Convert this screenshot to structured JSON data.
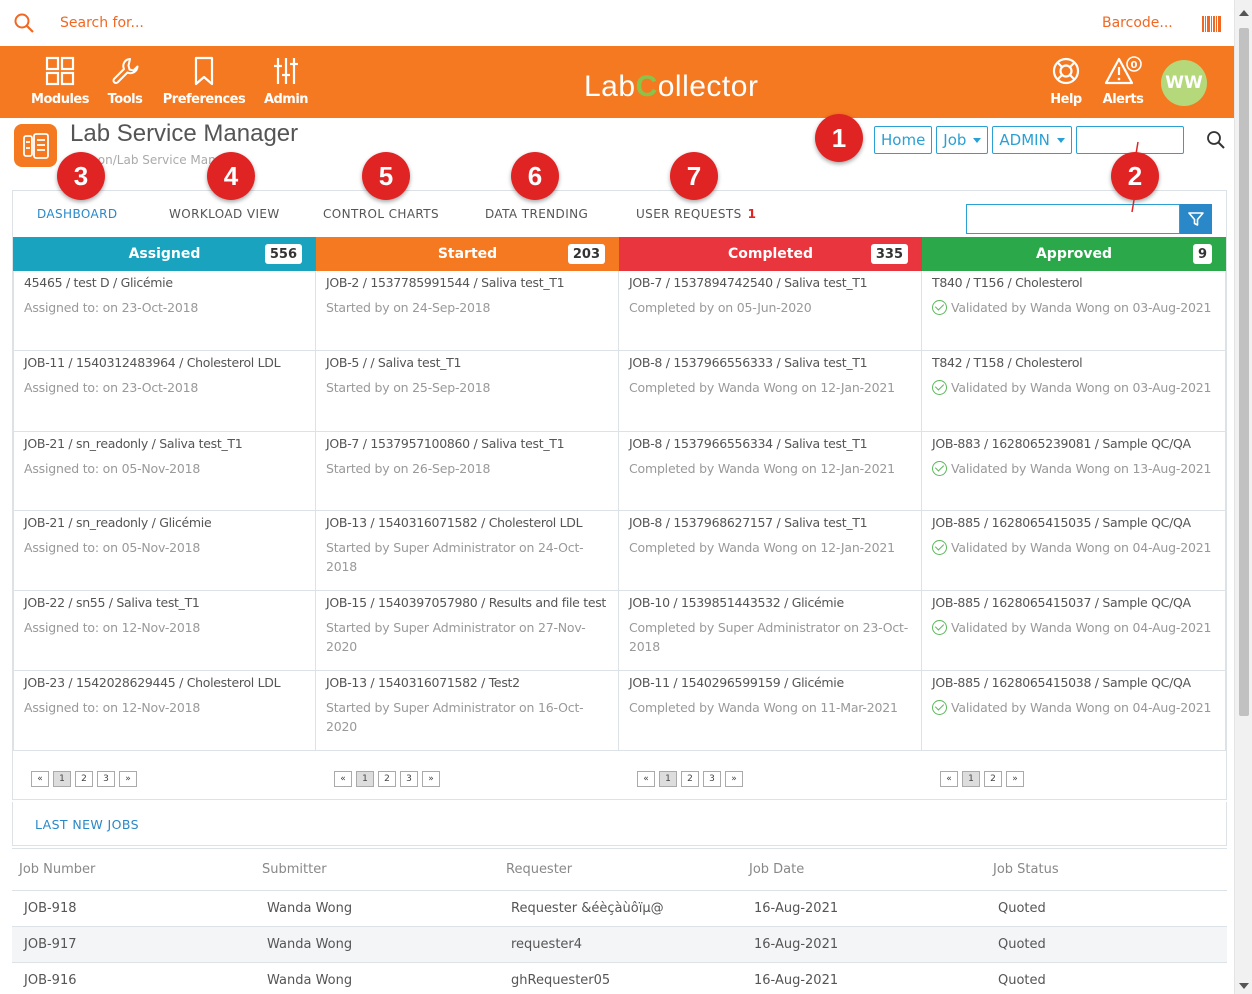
{
  "search": {
    "placeholder": "Search for...",
    "barcode_label": "Barcode..."
  },
  "nav": {
    "items": [
      {
        "label": "Modules",
        "icon": "grid-icon"
      },
      {
        "label": "Tools",
        "icon": "wrench-icon"
      },
      {
        "label": "Preferences",
        "icon": "bookmark-icon"
      },
      {
        "label": "Admin",
        "icon": "sliders-icon"
      }
    ],
    "logo_left": "Lab",
    "logo_c": "C",
    "logo_right": "ollector",
    "help_label": "Help",
    "alerts_label": "Alerts",
    "alerts_count": "0",
    "avatar_initials": "WW",
    "accent_color": "#f47920"
  },
  "header": {
    "title": "Lab Service Manager",
    "breadcrumb": "Add-on/Lab Service Manager",
    "home_btn": "Home",
    "job_btn": "Job",
    "admin_btn": "ADMIN"
  },
  "callouts": [
    "1",
    "2",
    "3",
    "4",
    "5",
    "6",
    "7"
  ],
  "tabs": [
    {
      "label": "DASHBOARD",
      "active": true
    },
    {
      "label": "WORKLOAD VIEW"
    },
    {
      "label": "CONTROL CHARTS"
    },
    {
      "label": "DATA TRENDING"
    },
    {
      "label": "USER REQUESTS",
      "count": "1"
    }
  ],
  "columns": [
    {
      "name": "Assigned",
      "count": "556",
      "color": "#1aa3bf",
      "cards": [
        {
          "title": "45465 / test D / Glicémie",
          "line": "Assigned to: on 23-Oct-2018"
        },
        {
          "title": "JOB-11 / 1540312483964 / Cholesterol LDL",
          "line": "Assigned to: on 23-Oct-2018"
        },
        {
          "title": "JOB-21 / sn_readonly / Saliva test_T1",
          "line": "Assigned to: on 05-Nov-2018"
        },
        {
          "title": "JOB-21 / sn_readonly / Glicémie",
          "line": "Assigned to: on 05-Nov-2018"
        },
        {
          "title": "JOB-22 / sn55 / Saliva test_T1",
          "line": "Assigned to: on 12-Nov-2018"
        },
        {
          "title": "JOB-23 / 1542028629445 / Cholesterol LDL",
          "line": "Assigned to: on 12-Nov-2018"
        }
      ],
      "pages": [
        "«",
        "1",
        "2",
        "3",
        "»"
      ]
    },
    {
      "name": "Started",
      "count": "203",
      "color": "#f47920",
      "cards": [
        {
          "title": "JOB-2 / 1537785991544 / Saliva test_T1",
          "line": "Started by on 24-Sep-2018"
        },
        {
          "title": "JOB-5 / / Saliva test_T1",
          "line": "Started by on 25-Sep-2018"
        },
        {
          "title": "JOB-7 / 1537957100860 / Saliva test_T1",
          "line": "Started by on 26-Sep-2018"
        },
        {
          "title": "JOB-13 / 1540316071582 / Cholesterol LDL",
          "line": "Started by Super Administrator on 24-Oct-2018"
        },
        {
          "title": "JOB-15 / 1540397057980 / Results and file test",
          "line": "Started by Super Administrator on 27-Nov-2020"
        },
        {
          "title": "JOB-13 / 1540316071582 / Test2",
          "line": "Started by Super Administrator on 16-Oct-2020"
        }
      ],
      "pages": [
        "«",
        "1",
        "2",
        "3",
        "»"
      ]
    },
    {
      "name": "Completed",
      "count": "335",
      "color": "#e8353e",
      "cards": [
        {
          "title": "JOB-7 / 1537894742540 / Saliva test_T1",
          "line": "Completed by on 05-Jun-2020"
        },
        {
          "title": "JOB-8 / 1537966556333 / Saliva test_T1",
          "line": "Completed by Wanda Wong on 12-Jan-2021"
        },
        {
          "title": "JOB-8 / 1537966556334 / Saliva test_T1",
          "line": "Completed by Wanda Wong on 12-Jan-2021"
        },
        {
          "title": "JOB-8 / 1537968627157 / Saliva test_T1",
          "line": "Completed by Wanda Wong on 12-Jan-2021"
        },
        {
          "title": "JOB-10 / 1539851443532 / Glicémie",
          "line": "Completed by Super Administrator on 23-Oct-2018"
        },
        {
          "title": "JOB-11 / 1540296599159 / Glicémie",
          "line": "Completed by Wanda Wong on 11-Mar-2021"
        }
      ],
      "pages": [
        "«",
        "1",
        "2",
        "3",
        "»"
      ]
    },
    {
      "name": "Approved",
      "count": "9",
      "color": "#2aa84a",
      "cards": [
        {
          "title": "T840 / T156 / Cholesterol",
          "line": "Validated by Wanda Wong on 03-Aug-2021"
        },
        {
          "title": "T842 / T158 / Cholesterol",
          "line": "Validated by Wanda Wong on 03-Aug-2021"
        },
        {
          "title": "JOB-883 / 1628065239081 / Sample QC/QA",
          "line": "Validated by Wanda Wong on 13-Aug-2021"
        },
        {
          "title": "JOB-885 / 1628065415035 / Sample QC/QA",
          "line": "Validated by Wanda Wong on 04-Aug-2021"
        },
        {
          "title": "JOB-885 / 1628065415037 / Sample QC/QA",
          "line": "Validated by Wanda Wong on 04-Aug-2021"
        },
        {
          "title": "JOB-885 / 1628065415038 / Sample QC/QA",
          "line": "Validated by Wanda Wong on 04-Aug-2021"
        }
      ],
      "pages": [
        "«",
        "1",
        "2",
        "»"
      ]
    }
  ],
  "last_jobs": {
    "title": "LAST NEW JOBS",
    "headers": [
      "Job Number",
      "Submitter",
      "Requester",
      "Job Date",
      "Job Status"
    ],
    "rows": [
      [
        "JOB-918",
        "Wanda Wong",
        "Requester &éèçàùôïµ@",
        "16-Aug-2021",
        "Quoted"
      ],
      [
        "JOB-917",
        "Wanda Wong",
        "requester4",
        "16-Aug-2021",
        "Quoted"
      ],
      [
        "JOB-916",
        "Wanda Wong",
        "ghRequester05",
        "16-Aug-2021",
        "Quoted"
      ]
    ]
  }
}
